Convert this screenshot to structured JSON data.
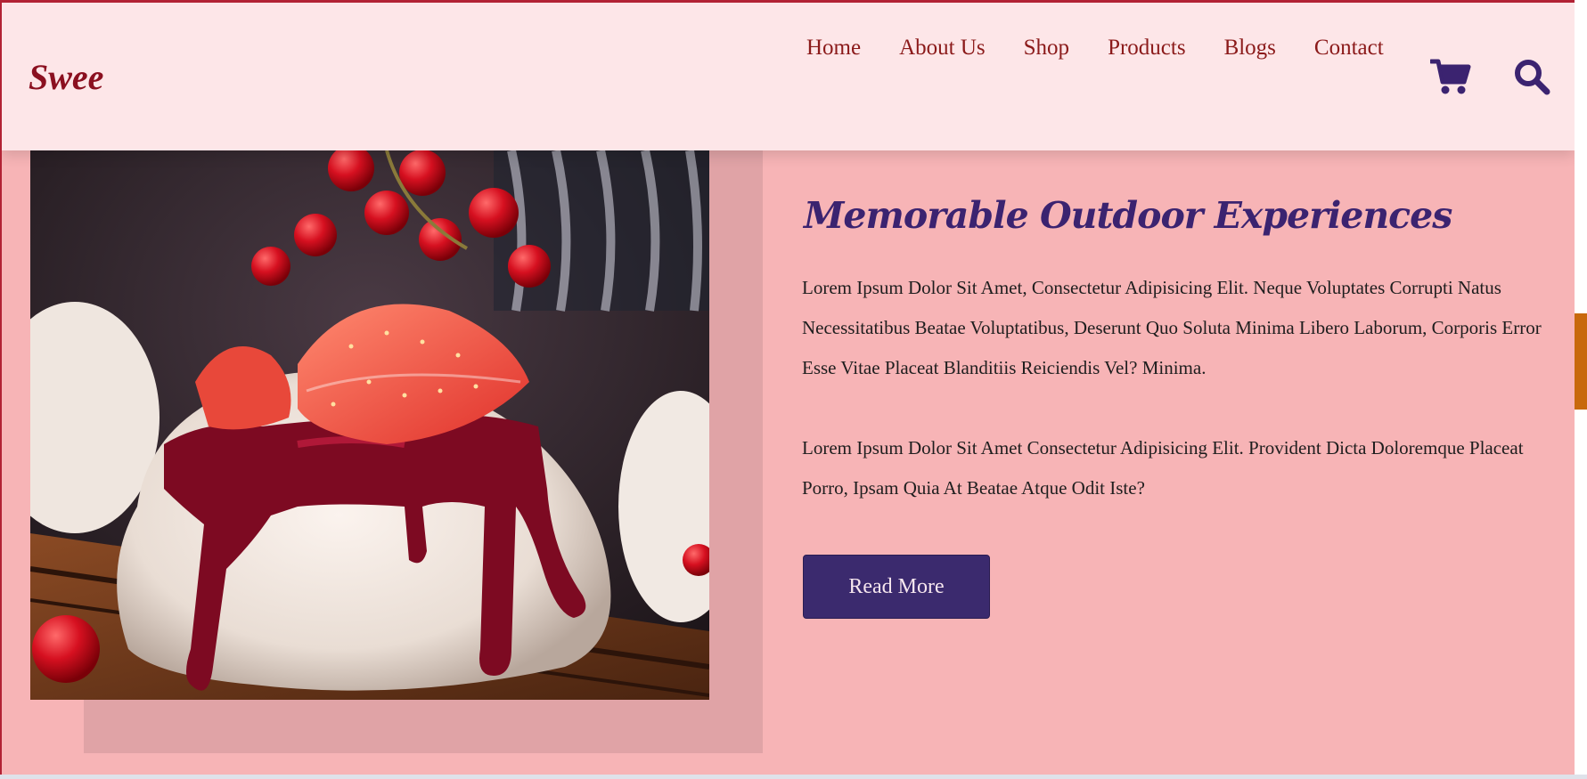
{
  "header": {
    "logo": "Swee",
    "nav": [
      "Home",
      "About Us",
      "Shop",
      "Products",
      "Blogs",
      "Contact"
    ],
    "icons": [
      "shopping-cart-icon",
      "search-icon"
    ]
  },
  "main": {
    "heading": "Memorable Outdoor Experiences",
    "paragraph1": "Lorem Ipsum Dolor Sit Amet, Consectetur Adipisicing Elit. Neque Voluptates Corrupti Natus Necessitatibus Beatae Voluptatibus, Deserunt Quo Soluta Minima Libero Laborum, Corporis Error Esse Vitae Placeat Blanditiis Reiciendis Vel? Minima.",
    "paragraph2": "Lorem Ipsum Dolor Sit Amet Consectetur Adipisicing Elit. Provident Dicta Doloremque Placeat Porro, Ipsam Quia At Beatae Atque Odit Iste?",
    "button": "Read More"
  },
  "colors": {
    "accent": "#3b2a6e",
    "brand": "#8b1020",
    "header_bg": "#fde6e8",
    "section_bg": "#f7b4b6"
  }
}
